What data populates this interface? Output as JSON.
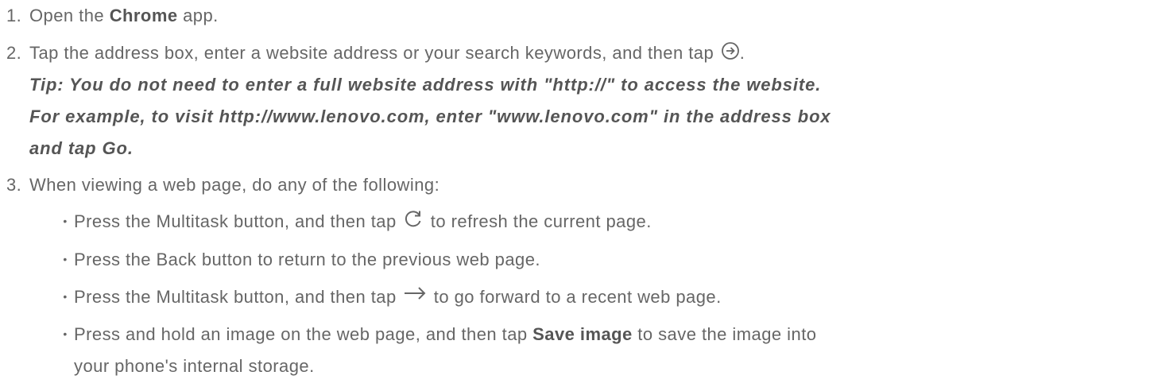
{
  "steps": [
    {
      "number": "1.",
      "before": "Open the ",
      "bold": "Chrome",
      "after": " app."
    },
    {
      "number": "2.",
      "before": "Tap the address box, enter a website address or your search keywords, and then tap ",
      "icon": "go-circle-arrow-icon",
      "after": ".",
      "tip_lines": [
        "Tip: You do not need to enter a full website address with \"http://\" to access the website.",
        "For example, to visit http://www.lenovo.com, enter \"www.lenovo.com\" in the address box",
        "and tap Go."
      ]
    },
    {
      "number": "3.",
      "text": "When viewing a web page, do any of the following:",
      "bullets": [
        {
          "before": "Press the Multitask button, and then tap ",
          "icon": "refresh-icon",
          "after": " to refresh the current page."
        },
        {
          "text": "Press the Back button to return to the previous web page."
        },
        {
          "before": "Press the Multitask button, and then tap ",
          "icon": "forward-arrow-icon",
          "after": " to go forward to a recent web page."
        },
        {
          "before": "Press and hold an image on the web page, and then tap ",
          "bold": "Save image",
          "after": " to save the image into",
          "continuation": "your phone's internal storage."
        }
      ]
    }
  ],
  "bullet_char": "•",
  "colors": {
    "text": "#666666",
    "emphasis": "#555555",
    "background": "#ffffff"
  }
}
